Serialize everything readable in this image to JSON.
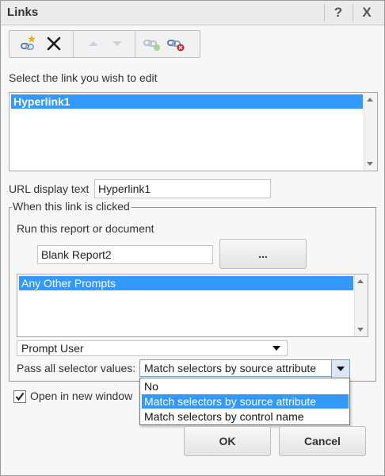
{
  "window": {
    "title": "Links",
    "help_glyph": "?",
    "close_glyph": "X"
  },
  "toolbar": {
    "items": [
      "new-link-icon",
      "delete-icon",
      "move-up-icon",
      "move-down-icon",
      "link-add-icon",
      "link-remove-icon"
    ]
  },
  "links_section": {
    "prompt": "Select the link you wish to edit",
    "links": [
      "Hyperlink1"
    ]
  },
  "url_display": {
    "label": "URL display text",
    "value": "Hyperlink1"
  },
  "click_group": {
    "legend": "When this link is clicked",
    "run_label": "Run this report or document",
    "report_value": "Blank Report2",
    "browse_label": "...",
    "prompts": [
      "Any Other Prompts"
    ],
    "prompt_behavior": "Prompt User",
    "selector_label": "Pass all selector values:",
    "selector_value": "Match selectors by source attribute",
    "selector_options": [
      "No",
      "Match selectors by source attribute",
      "Match selectors by control name"
    ]
  },
  "open_new_window": {
    "label": "Open in new window",
    "checked": true
  },
  "buttons": {
    "ok": "OK",
    "cancel": "Cancel"
  },
  "colors": {
    "selection": "#3399ff",
    "dialog_bg": "#f7f7f7"
  }
}
